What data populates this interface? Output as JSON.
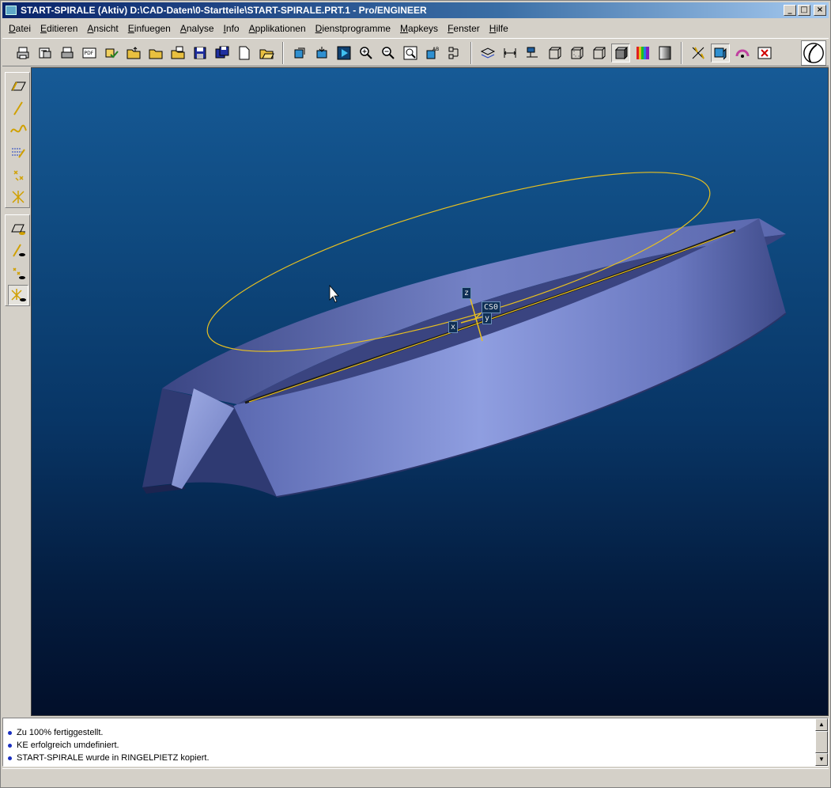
{
  "window": {
    "title": "START-SPIRALE (Aktiv)  D:\\CAD-Daten\\0-Startteile\\START-SPIRALE.PRT.1 - Pro/ENGINEER",
    "minimize_glyph": "_",
    "maximize_glyph": "□",
    "close_glyph": "×"
  },
  "menubar": {
    "items": [
      "Datei",
      "Editieren",
      "Ansicht",
      "Einfuegen",
      "Analyse",
      "Info",
      "Applikationen",
      "Dienstprogramme",
      "Mapkeys",
      "Fenster",
      "Hilfe"
    ]
  },
  "toolbar": {
    "icons": [
      "print-icon",
      "print-preview-icon",
      "printer-icon",
      "pdf-export-icon",
      "check-out-icon",
      "open-folder-icon",
      "folder-icon",
      "folder-copy-icon",
      "save-icon",
      "save-copy-icon",
      "new-file-icon",
      "open-file-icon",
      "regenerate-icon",
      "erase-icon",
      "play-icon",
      "zoom-in-icon",
      "zoom-out-icon",
      "zoom-fit-icon",
      "named-view-icon",
      "orient-icon",
      "layers-icon",
      "dimension-icon",
      "model-tree-icon",
      "wireframe-icon",
      "hidden-line-icon",
      "no-hidden-icon",
      "shaded-icon",
      "appearance-icon",
      "gray-icon",
      "datum-axes-icon",
      "datum-planes-icon",
      "spin-center-icon",
      "close-window-icon"
    ]
  },
  "left_toolbar": {
    "icons": [
      "datum-plane-icon",
      "datum-axis-icon",
      "datum-curve-icon",
      "sketch-icon",
      "datum-point-icon",
      "coordinate-system-icon",
      "plane-display-icon",
      "axis-display-icon",
      "point-display-icon",
      "csys-display-icon"
    ]
  },
  "viewport": {
    "csys_label": "CS0",
    "axis_x": "x",
    "axis_y": "y",
    "axis_z": "z",
    "model_color": "#8a98d8",
    "curve_color": "#e8c020",
    "background_top": "#165a96",
    "background_bottom": "#020f2a"
  },
  "messages": [
    "Zu 100% fertiggestellt.",
    "KE erfolgreich umdefiniert.",
    "START-SPIRALE wurde in RINGELPIETZ kopiert."
  ],
  "colors": {
    "titlebar_start": "#0a246a",
    "titlebar_end": "#a6caf0",
    "message_bullet": "#1a2fc0"
  }
}
